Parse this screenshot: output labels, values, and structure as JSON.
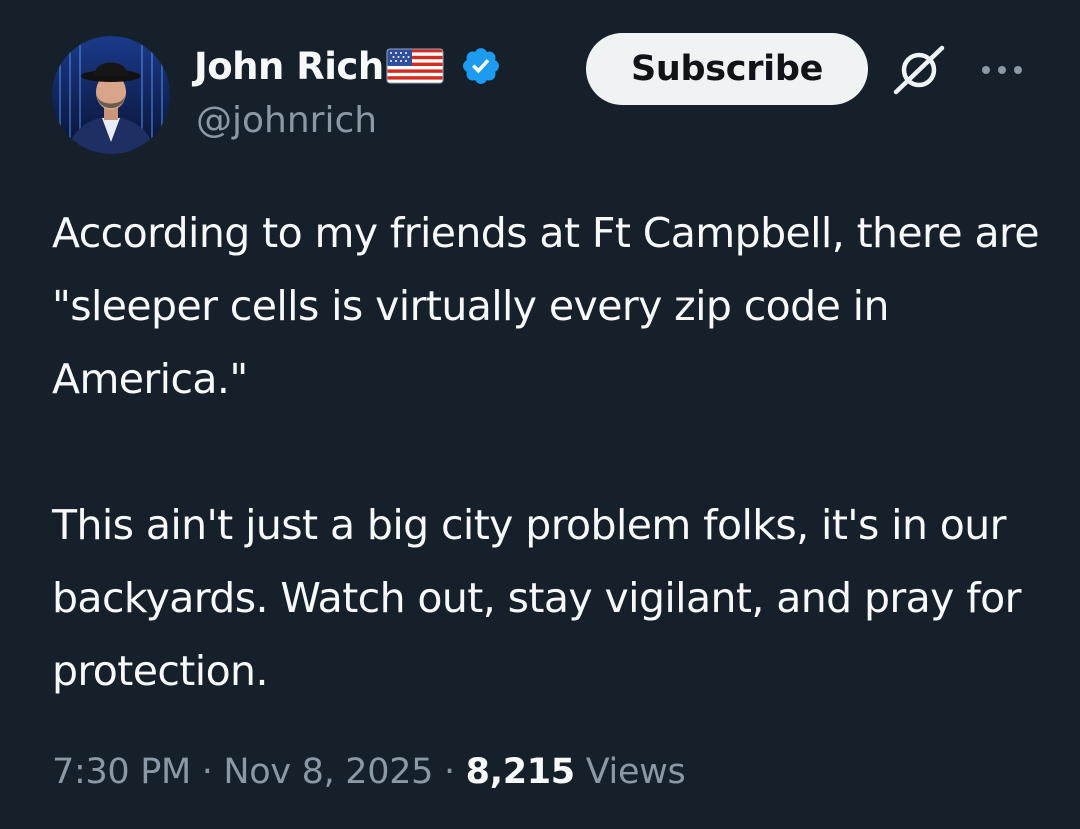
{
  "tweet": {
    "author": {
      "display_name": "John Rich",
      "flag_emoji_icon": "us-flag-icon",
      "verified_icon": "verified-badge-icon",
      "verified_color": "#1d9bf0",
      "handle": "@johnrich"
    },
    "actions": {
      "subscribe_label": "Subscribe",
      "grok_icon": "grok-icon",
      "more_icon": "more-options-icon"
    },
    "text": {
      "paragraph_1": "According to my friends at Ft Campbell, there are \"sleeper cells is virtually every zip code in America.\"",
      "paragraph_2": "This ain't just a big city problem folks, it's in our backyards. Watch out, stay vigilant, and pray for protection."
    },
    "meta": {
      "time": "7:30 PM",
      "separator": "·",
      "date": "Nov 8, 2025",
      "views_count": "8,215",
      "views_label": "Views"
    }
  },
  "colors": {
    "background": "#15202b",
    "primary_text": "#f7f9f9",
    "secondary_text": "#8b98a5",
    "button_bg": "#eff3f4"
  }
}
